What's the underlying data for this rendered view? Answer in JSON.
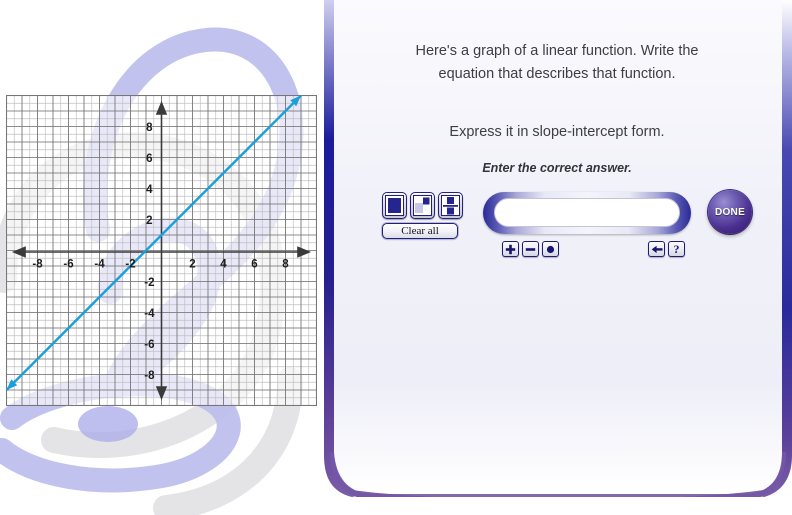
{
  "prompt": {
    "main": "Here's a graph of a linear function. Write the equation that describes that function.",
    "sub": "Express it in slope-intercept form.",
    "hint": "Enter the correct answer."
  },
  "toolbar": {
    "template_buttons": [
      {
        "name": "text-box-template",
        "label": ""
      },
      {
        "name": "exponent-template",
        "label": ""
      },
      {
        "name": "fraction-template",
        "label": ""
      }
    ],
    "clear_all_label": "Clear all"
  },
  "answer": {
    "value": "",
    "placeholder": ""
  },
  "operators": {
    "left": [
      {
        "name": "plus-button",
        "glyph": "+"
      },
      {
        "name": "minus-button",
        "glyph": "−"
      },
      {
        "name": "dot-multiply-button",
        "glyph": "●"
      }
    ],
    "right": [
      {
        "name": "backspace-button",
        "glyph": "←"
      },
      {
        "name": "help-button",
        "glyph": "?"
      }
    ]
  },
  "done": {
    "label": "DONE"
  },
  "colors": {
    "line": "#1a9fdc",
    "axis": "#404040",
    "grid_minor": "#b9b9b9",
    "grid_major": "#6e6e6e",
    "panel_border": "#2a2a96",
    "done_purple": "#4b2f8f",
    "text": "#3d3d44",
    "deco_purple": "#b9b9ee",
    "deco_gray": "#e2e2e2"
  },
  "chart_data": {
    "type": "line",
    "title": "",
    "xlabel": "",
    "ylabel": "",
    "xlim": [
      -10,
      10
    ],
    "ylim": [
      -10,
      10
    ],
    "grid": true,
    "legend": "none",
    "x_ticks": [
      -8,
      -6,
      -4,
      -2,
      2,
      4,
      6,
      8
    ],
    "y_ticks": [
      8,
      6,
      4,
      2,
      -2,
      -4,
      -6,
      -8
    ],
    "x_tick_labels": [
      "-8",
      "-6",
      "-4",
      "-2",
      "2",
      "4",
      "6",
      "8"
    ],
    "y_tick_labels": [
      "8",
      "6",
      "4",
      "2",
      "-2",
      "-4",
      "-6",
      "-8"
    ],
    "minor_step": 0.5,
    "major_step": 1,
    "series": [
      {
        "name": "linear function",
        "equation": "y = x + 1",
        "slope": 1,
        "intercept": 1,
        "color": "#1a9fdc",
        "arrows": "both",
        "x": [
          -10,
          10
        ],
        "y": [
          -9,
          11
        ],
        "points": [
          [
            -1,
            0
          ],
          [
            0,
            1
          ],
          [
            2,
            3
          ],
          [
            5,
            6
          ]
        ]
      }
    ]
  }
}
